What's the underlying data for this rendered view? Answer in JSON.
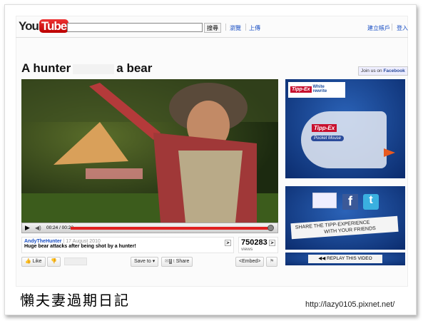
{
  "header": {
    "logo_you": "You",
    "logo_tube": "Tube",
    "search_button": "搜尋",
    "browse": "瀏覽",
    "upload": "上傳",
    "create_account": "建立帳戶",
    "sign_in": "登入"
  },
  "video": {
    "title_part1": "A hunter",
    "title_part2": "a bear",
    "facebook_prefix": "Join us on",
    "facebook_name": "Facebook",
    "time": "00:24 / 00:22",
    "progress": 1.0,
    "uploader": "AndyTheHunter",
    "date": "17 August 2010",
    "description": "Huge bear attacks after being shot by a hunter!",
    "views": "750283",
    "views_label": "views"
  },
  "actions": {
    "like": "Like",
    "save_to": "Save to",
    "share": "Share",
    "embed": "<Embed>"
  },
  "ad": {
    "brand": "Tipp-Ex",
    "tagline1": "White",
    "tagline2": "rewrite",
    "product": "Pocket Mouse",
    "share_line1": "SHARE THE TIPP-EXPERIENCE",
    "share_line2": "WITH YOUR FRIENDS",
    "replay": "REPLAY THIS VIDEO"
  },
  "footer": {
    "blog_title": "懶夫妻過期日記",
    "url": "http://lazy0105.pixnet.net/"
  },
  "colors": {
    "accent": "#e02020",
    "link": "#1a4fc4",
    "ad_blue": "#1b4d9e"
  }
}
